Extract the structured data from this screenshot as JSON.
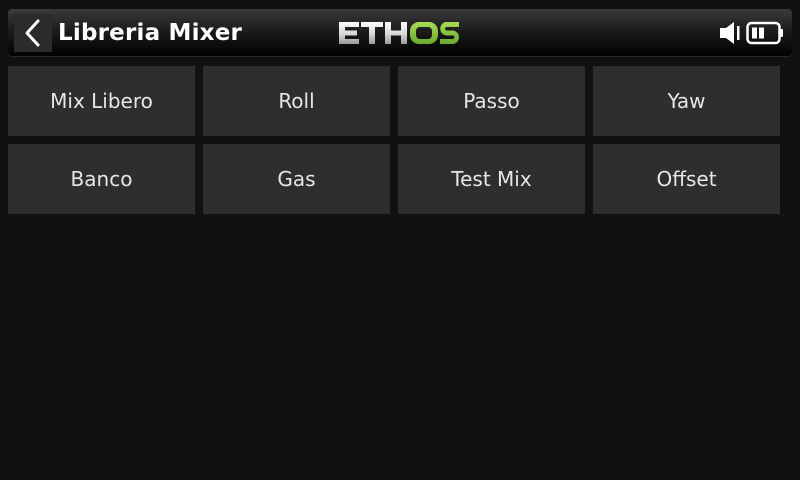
{
  "header": {
    "title": "Libreria Mixer",
    "back_icon": "chevron-left-icon",
    "logo": {
      "text_white": "ETH",
      "text_green": "OS",
      "green_color": "#7ac143"
    },
    "status_icons": [
      "speaker-icon",
      "battery-icon"
    ]
  },
  "mixers": [
    {
      "label": "Mix Libero"
    },
    {
      "label": "Roll"
    },
    {
      "label": "Passo"
    },
    {
      "label": "Yaw"
    },
    {
      "label": "Banco"
    },
    {
      "label": "Gas"
    },
    {
      "label": "Test Mix"
    },
    {
      "label": "Offset"
    }
  ],
  "colors": {
    "background": "#111111",
    "tile": "#2e2e2e",
    "text": "#e6e6e6"
  }
}
